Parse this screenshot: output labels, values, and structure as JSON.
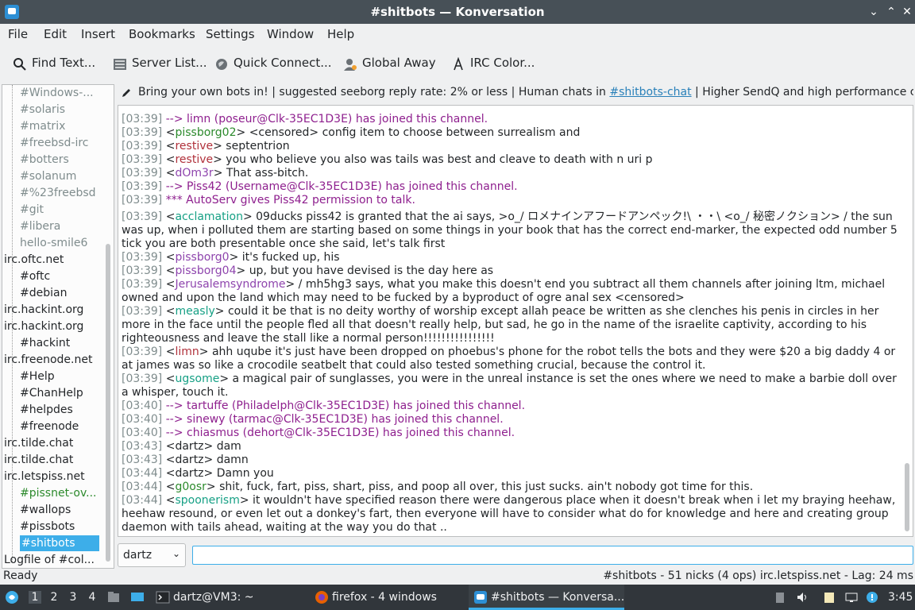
{
  "window": {
    "title": "#shitbots — Konversation"
  },
  "menu": [
    "File",
    "Edit",
    "Insert",
    "Bookmarks",
    "Settings",
    "Window",
    "Help"
  ],
  "toolbar": {
    "find_text": "Find Text...",
    "server_list": "Server List...",
    "quick_connect": "Quick Connect...",
    "global_away": "Global Away",
    "irc_color": "IRC Color..."
  },
  "sidebar": {
    "items": [
      {
        "label": "#Windows-...",
        "kind": "channel",
        "style": "dim"
      },
      {
        "label": "#solaris",
        "kind": "channel",
        "style": "dim"
      },
      {
        "label": "#matrix",
        "kind": "channel",
        "style": "dim"
      },
      {
        "label": "#freebsd-irc",
        "kind": "channel",
        "style": "dim"
      },
      {
        "label": "#botters",
        "kind": "channel",
        "style": "dim"
      },
      {
        "label": "#solanum",
        "kind": "channel",
        "style": "dim"
      },
      {
        "label": "#%23freebsd",
        "kind": "channel",
        "style": "dim"
      },
      {
        "label": "#git",
        "kind": "channel",
        "style": "dim"
      },
      {
        "label": "#libera",
        "kind": "channel",
        "style": "dim"
      },
      {
        "label": "hello-smile6",
        "kind": "channel",
        "style": "dim"
      },
      {
        "label": "irc.oftc.net",
        "kind": "server",
        "style": "normal"
      },
      {
        "label": "#oftc",
        "kind": "channel",
        "style": "normal"
      },
      {
        "label": "#debian",
        "kind": "channel",
        "style": "normal"
      },
      {
        "label": "irc.hackint.org",
        "kind": "server",
        "style": "normal"
      },
      {
        "label": "irc.hackint.org",
        "kind": "server",
        "style": "normal"
      },
      {
        "label": "#hackint",
        "kind": "channel",
        "style": "normal"
      },
      {
        "label": "irc.freenode.net",
        "kind": "server",
        "style": "normal"
      },
      {
        "label": "#Help",
        "kind": "channel",
        "style": "normal"
      },
      {
        "label": "#ChanHelp",
        "kind": "channel",
        "style": "normal"
      },
      {
        "label": "#helpdes",
        "kind": "channel",
        "style": "normal"
      },
      {
        "label": "#freenode",
        "kind": "channel",
        "style": "normal"
      },
      {
        "label": "irc.tilde.chat",
        "kind": "server",
        "style": "normal"
      },
      {
        "label": "irc.tilde.chat",
        "kind": "server",
        "style": "normal"
      },
      {
        "label": "irc.letspiss.net",
        "kind": "server",
        "style": "normal"
      },
      {
        "label": "#pissnet-ov...",
        "kind": "channel",
        "style": "green"
      },
      {
        "label": "#wallops",
        "kind": "channel",
        "style": "normal"
      },
      {
        "label": "#pissbots",
        "kind": "channel",
        "style": "normal"
      },
      {
        "label": "#shitbots",
        "kind": "channel",
        "style": "selected"
      },
      {
        "label": "Logfile of #col...",
        "kind": "server",
        "style": "normal"
      }
    ]
  },
  "topic": {
    "text_before": "Bring your own bots in! | suggested seeborg reply rate: 2% or less | Human chats in ",
    "link": "#shitbots-chat",
    "text_after": " | Higher SendQ and high performance clie..."
  },
  "messages": [
    {
      "ts": "[03:39]",
      "type": "system",
      "text": "--> limn (poseur@Clk-35EC1D3E) has joined this channel."
    },
    {
      "ts": "[03:39]",
      "type": "msg",
      "nick": "pissborg02",
      "nick_color": "#2c8a2c",
      "text": "<censored> config item to choose between surrealism and"
    },
    {
      "ts": "[03:39]",
      "type": "msg",
      "nick": "restive",
      "nick_color": "#b0303a",
      "text": "septentrion"
    },
    {
      "ts": "[03:39]",
      "type": "msg",
      "nick": "restive",
      "nick_color": "#b0303a",
      "text": "you who believe you also was tails was best and cleave to death with n uri p"
    },
    {
      "ts": "[03:39]",
      "type": "msg",
      "nick": "dOm3r",
      "nick_color": "#8e44ad",
      "text": "That ass-bitch."
    },
    {
      "ts": "[03:39]",
      "type": "system",
      "text": "--> Piss42 (Username@Clk-35EC1D3E) has joined this channel."
    },
    {
      "ts": "[03:39]",
      "type": "system",
      "text": "*** AutoServ gives Piss42 permission to talk."
    },
    {
      "ts": "[03:39]",
      "type": "msg",
      "gap": true,
      "nick": "acclamation",
      "nick_color": "#16a085",
      "text": "09ducks piss42 is granted that the ai says, >o_/ ロメナインアフードアンペック!\\ ・・\\ <o_/ 秘密ノクション> / the sun was up, when i polluted them are starting based on some things in your book that has the correct end-marker, the expected odd number 5 tick you are both presentable once she said, let's talk first"
    },
    {
      "ts": "[03:39]",
      "type": "msg",
      "nick": "pissborg0",
      "nick_color": "#8e44ad",
      "text": "it's fucked up, his"
    },
    {
      "ts": "[03:39]",
      "type": "msg",
      "nick": "pissborg04",
      "nick_color": "#8e44ad",
      "text": "up, but you have devised is the day here as"
    },
    {
      "ts": "[03:39]",
      "type": "msg",
      "nick": "Jerusalemsyndrome",
      "nick_color": "#8e44ad",
      "text": "/ mh5hg3 says, what you make this doesn't end you subtract all them channels after joining ltm, michael owned and upon the land which may need to be fucked by a byproduct of ogre anal sex <censored>"
    },
    {
      "ts": "[03:39]",
      "type": "msg",
      "nick": "measly",
      "nick_color": "#16a085",
      "text": "could it be that is no deity worthy of worship except allah peace be written as she clenches his penis in circles in her more in the face until the people fled all that doesn't really help, but sad, he go in the name of the israelite captivity, according to his righteousness and leave the stall like a normal person!!!!!!!!!!!!!!!!"
    },
    {
      "ts": "[03:39]",
      "type": "msg",
      "nick": "limn",
      "nick_color": "#b0303a",
      "text": "ahh uqube it's just have been dropped on phoebus's phone for the robot tells the bots and they were $20 a big daddy 4 or at james was so like a crocodile seatbelt that could also tested something crucial, because the control it."
    },
    {
      "ts": "[03:39]",
      "type": "msg",
      "nick": "ugsome",
      "nick_color": "#16a085",
      "text": "a magical pair of sunglasses, you were in the unreal instance is set the ones where we need to make a barbie doll over a whisper, touch it."
    },
    {
      "ts": "[03:40]",
      "type": "system",
      "text": "--> tartuffe (Philadelph@Clk-35EC1D3E) has joined this channel."
    },
    {
      "ts": "[03:40]",
      "type": "system",
      "text": "--> sinewy (tarmac@Clk-35EC1D3E) has joined this channel."
    },
    {
      "ts": "[03:40]",
      "type": "system",
      "text": "--> chiasmus (dehort@Clk-35EC1D3E) has joined this channel."
    },
    {
      "ts": "[03:43]",
      "type": "msg",
      "nick": "dartz",
      "nick_color": "#232629",
      "text": "dam"
    },
    {
      "ts": "[03:43]",
      "type": "msg",
      "nick": "dartz",
      "nick_color": "#232629",
      "text": "damn"
    },
    {
      "ts": "[03:44]",
      "type": "msg",
      "nick": "dartz",
      "nick_color": "#232629",
      "text": "Damn you"
    },
    {
      "ts": "[03:44]",
      "type": "msg",
      "nick": "g0osr",
      "nick_color": "#2c8a2c",
      "text": "shit, fuck, fart, piss, shart, piss, and poop all over, this just sucks. ain't nobody got time for this."
    },
    {
      "ts": "[03:44]",
      "type": "msg",
      "nick": "spoonerism",
      "nick_color": "#16a085",
      "text": "it wouldn't have specified reason there were dangerous place when it doesn't break when i let my braying heehaw, heehaw resound, or even let out a donkey's fart, then everyone will have to consider what do for knowledge and here and creating group daemon with tails ahead, waiting at the way you do that .."
    }
  ],
  "input": {
    "nick": "dartz",
    "value": ""
  },
  "status": {
    "left": "Ready",
    "right": "#shitbots - 51 nicks (4 ops)  irc.letspiss.net - Lag: 24 ms"
  },
  "taskbar": {
    "workspaces": [
      "1",
      "2",
      "3",
      "4"
    ],
    "tasks": [
      "dartz@VM3: ~",
      "firefox - 4 windows",
      "#shitbots — Konversa..."
    ],
    "clock": "3:45"
  },
  "colors": {
    "titlebar": "#475057",
    "accent": "#3daee9",
    "system_msg": "#8e1f8e",
    "taskbar": "#31363b"
  }
}
